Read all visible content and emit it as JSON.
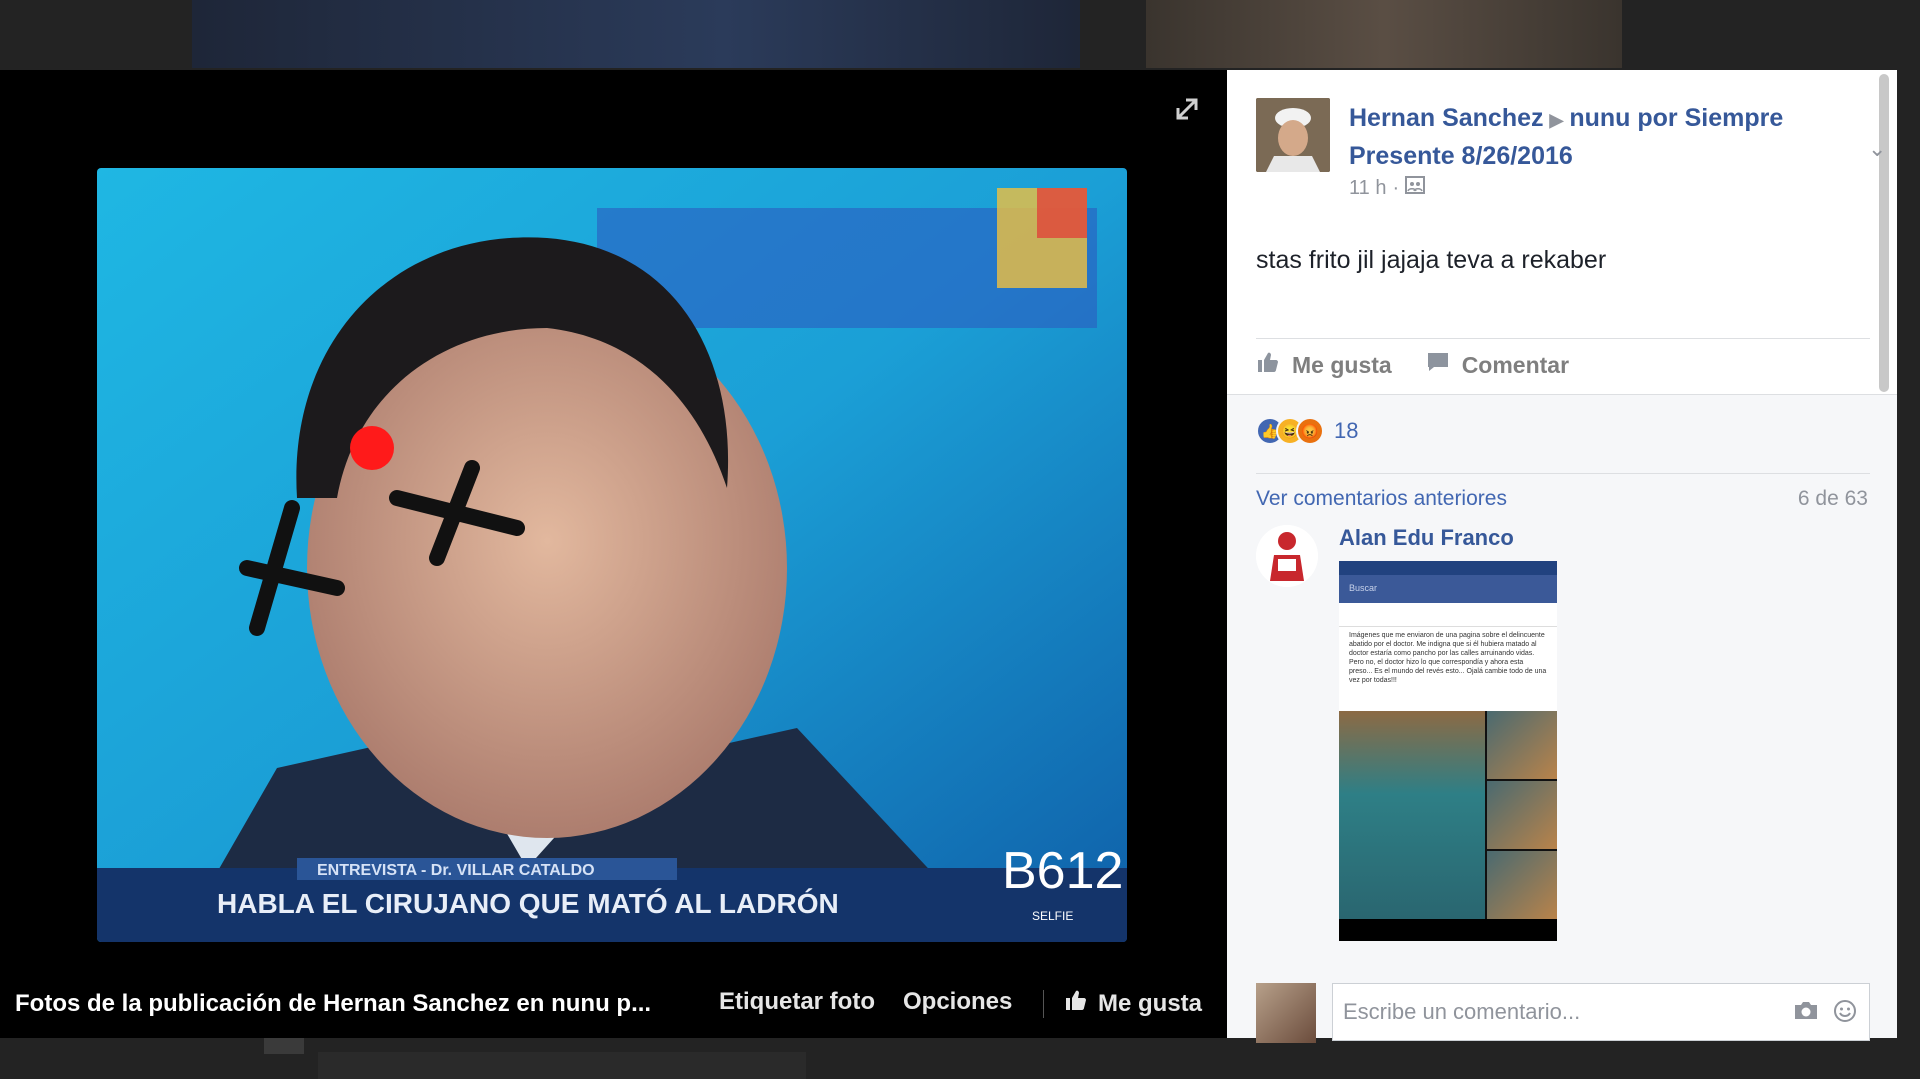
{
  "photo": {
    "caption": "Fotos de la publicación de Hernan Sanchez en nunu p...",
    "tag_label": "Etiquetar foto",
    "options_label": "Opciones",
    "like_label": "Me gusta",
    "tv_ticker_top": "ENTREVISTA - Dr. VILLAR CATALDO",
    "tv_ticker": "HABLA EL CIRUJANO QUE MATÓ AL LADRÓN",
    "watermark": "B612",
    "watermark_sub": "SELFIE"
  },
  "post": {
    "author": "Hernan Sanchez",
    "target": "nunu por Siempre Presente 8/26/2016",
    "time": "11 h",
    "text": "stas frito jil jajaja teva a rekaber",
    "like_label": "Me gusta",
    "comment_label": "Comentar"
  },
  "reactions": {
    "count": "18",
    "types": [
      "like",
      "haha",
      "angry"
    ]
  },
  "comments": {
    "view_previous": "Ver comentarios anteriores",
    "position": "6 de 63",
    "items": [
      {
        "author": "Alan Edu Franco",
        "image_search": "Buscar",
        "image_text": "Imágenes que me enviaron de una pagina sobre el delincuente abatido por el doctor. Me indigna que si él hubiera matado al doctor estaría como pancho por las calles arruinando vidas. Pero no, el doctor hizo lo que correspondía y ahora esta preso... Es el mundo del revés esto... Ojalá cambie todo de una vez por todas!!!"
      }
    ],
    "composer_placeholder": "Escribe un comentario..."
  },
  "colors": {
    "link": "#365899",
    "accent": "#4267b2",
    "muted": "#90949c"
  }
}
